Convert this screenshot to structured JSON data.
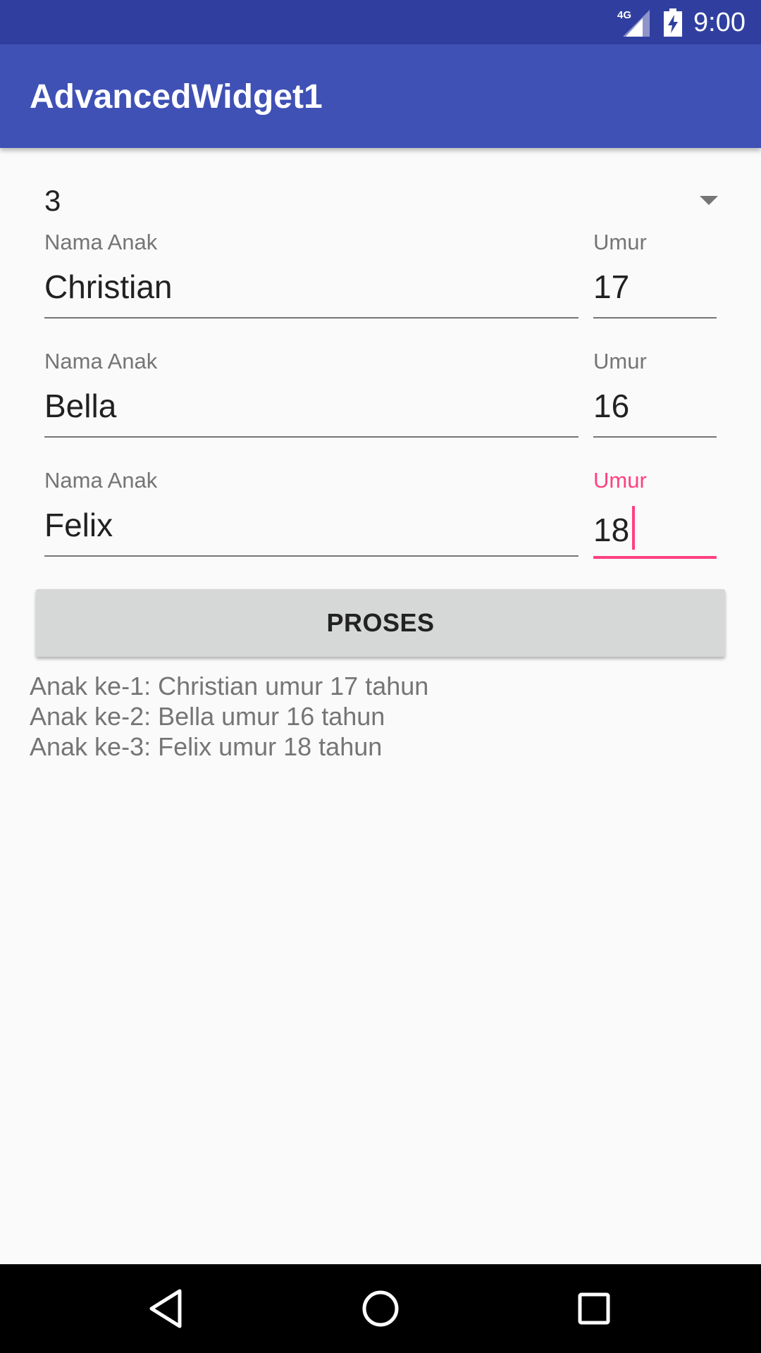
{
  "status_bar": {
    "network_label": "4G",
    "time": "9:00",
    "icons": [
      "signal-4g-icon",
      "battery-charging-icon"
    ]
  },
  "app_bar": {
    "title": "AdvancedWidget1"
  },
  "spinner": {
    "selected": "3"
  },
  "children": [
    {
      "name_label": "Nama Anak",
      "name_value": "Christian",
      "age_label": "Umur",
      "age_value": "17"
    },
    {
      "name_label": "Nama Anak",
      "name_value": "Bella",
      "age_label": "Umur",
      "age_value": "16"
    },
    {
      "name_label": "Nama Anak",
      "name_value": "Felix",
      "age_label": "Umur",
      "age_value": "18"
    }
  ],
  "focused_field": "children.2.age_value",
  "proses_button": {
    "label": "PROSES"
  },
  "results": [
    "Anak ke-1: Christian umur 17 tahun",
    "Anak ke-2: Bella umur 16 tahun",
    "Anak ke-3: Felix umur 18 tahun"
  ],
  "nav_bar": {
    "icons": [
      "back-icon",
      "home-icon",
      "recents-icon"
    ]
  },
  "colors": {
    "primary": "#3f51b5",
    "primary_dark": "#303f9f",
    "accent": "#ff4081",
    "background": "#fafafa",
    "button": "#d6d7d7"
  }
}
